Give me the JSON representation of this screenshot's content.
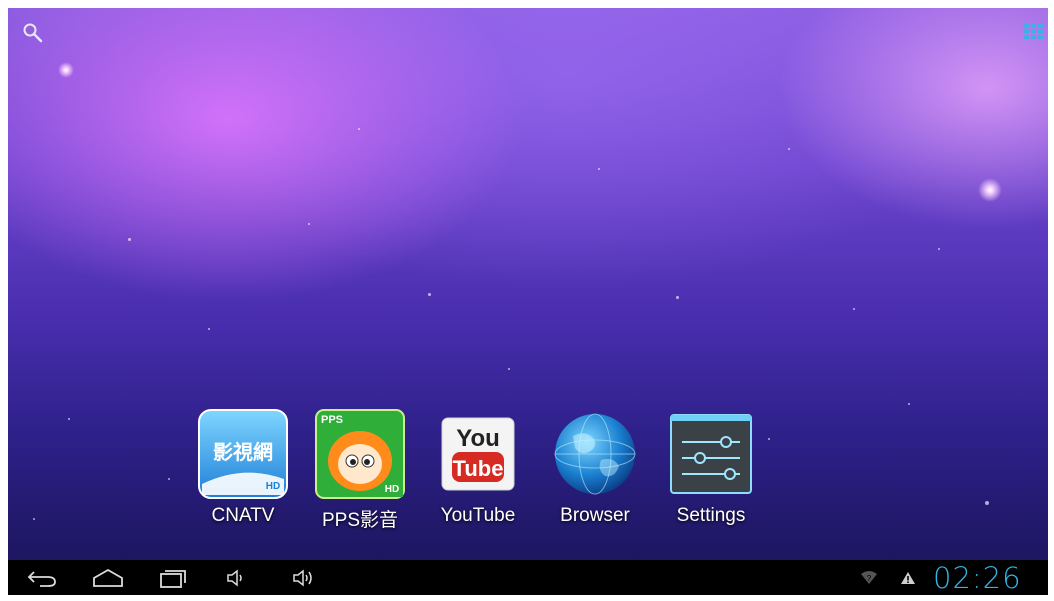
{
  "top_bar": {
    "search_icon": "search-icon",
    "all_apps_icon": "all-apps-grid-icon"
  },
  "dock": {
    "apps": [
      {
        "label": "CNATV",
        "icon": "cnatv-icon",
        "icon_text": "影視網",
        "badge": "HD"
      },
      {
        "label": "PPS影音",
        "icon": "pps-icon",
        "icon_text": "PPS",
        "badge": "HD"
      },
      {
        "label": "YouTube",
        "icon": "youtube-icon",
        "icon_text_top": "You",
        "icon_text_bottom": "Tube"
      },
      {
        "label": "Browser",
        "icon": "browser-globe-icon"
      },
      {
        "label": "Settings",
        "icon": "settings-sliders-icon"
      }
    ]
  },
  "navbar": {
    "buttons": [
      "back-icon",
      "home-icon",
      "recent-apps-icon",
      "volume-down-icon",
      "volume-up-icon"
    ],
    "status": {
      "wifi_icon": "wifi-unknown-icon",
      "warning_icon": "warning-icon",
      "clock": "02:26"
    }
  },
  "colors": {
    "clock": "#33b5e5",
    "navbar": "#000000"
  }
}
